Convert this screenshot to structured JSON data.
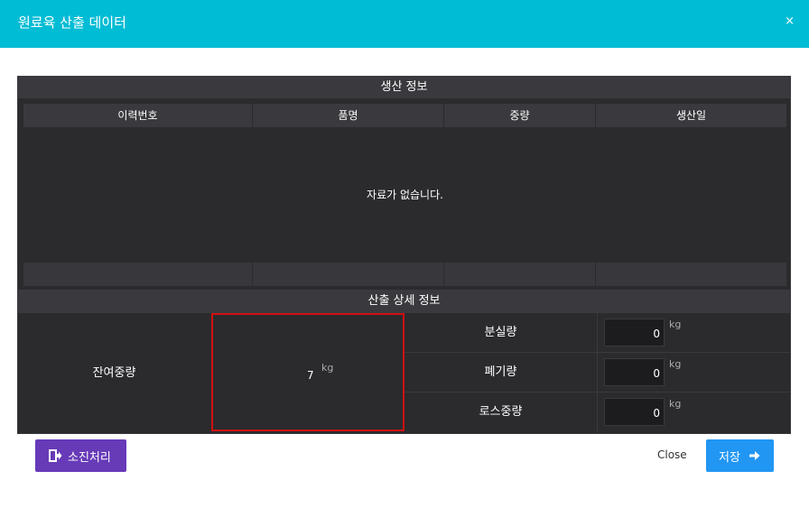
{
  "dialog": {
    "title": "원료육 산출 데이터",
    "close_icon": "×"
  },
  "production": {
    "section_title": "생산 정보",
    "columns": [
      "이력번호",
      "품명",
      "중량",
      "생산일"
    ],
    "empty_message": "자료가 없습니다."
  },
  "detail": {
    "section_title": "산출 상세 정보",
    "remaining": {
      "label": "잔여중량",
      "value": "7",
      "unit": "kg"
    },
    "rows": [
      {
        "label": "분실량",
        "value": "0",
        "unit": "kg"
      },
      {
        "label": "폐기량",
        "value": "0",
        "unit": "kg"
      },
      {
        "label": "로스중량",
        "value": "0",
        "unit": "kg"
      }
    ]
  },
  "footer": {
    "consume_label": "소진처리",
    "close_label": "Close",
    "save_label": "저장"
  }
}
